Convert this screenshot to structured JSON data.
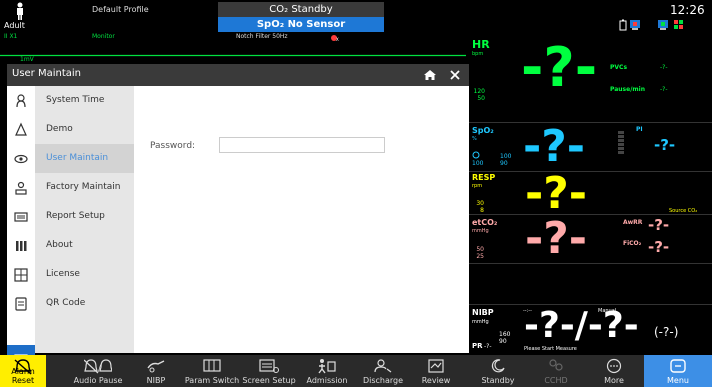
{
  "top": {
    "patient_type": "Adult",
    "profile": "Default Profile",
    "alarm_tech": "CO₂ Standby",
    "alarm_sensor": "SpO₂ No Sensor",
    "clock": "12:26"
  },
  "ecg": {
    "lead": "II  X1",
    "mode": "Monitor",
    "notch": "Notch Filter 50Hz",
    "scale": "1mV"
  },
  "dialog": {
    "title": "User Maintain",
    "password_label": "Password:",
    "password_value": "",
    "menu": [
      {
        "label": "System Time",
        "icon": "clock-icon"
      },
      {
        "label": "Demo",
        "icon": "bell-icon"
      },
      {
        "label": "User Maintain",
        "icon": "eye-icon"
      },
      {
        "label": "Factory Maintain",
        "icon": "factory-icon"
      },
      {
        "label": "Report Setup",
        "icon": "printer-icon"
      },
      {
        "label": "About",
        "icon": "bars-icon"
      },
      {
        "label": "License",
        "icon": "grid-icon"
      },
      {
        "label": "QR Code",
        "icon": "document-icon"
      }
    ],
    "active_item": "User Maintain"
  },
  "params": {
    "hr": {
      "label": "HR",
      "unit": "bpm",
      "hi": "120",
      "lo": "50",
      "value": "-?-",
      "pvcs_label": "PVCs",
      "pvcs_value": "-?-",
      "pause_label": "Pause/min",
      "pause_value": "-?-"
    },
    "spo2": {
      "label": "SpO₂",
      "unit": "%",
      "hi": "100",
      "lo": "90",
      "value": "-?-",
      "pi_label": "PI",
      "pi_value": "-?-",
      "extra_hi": "100"
    },
    "resp": {
      "label": "RESP",
      "unit": "rpm",
      "hi": "30",
      "lo": "8",
      "value": "-?-",
      "source": "Source CO₂"
    },
    "etco2": {
      "label": "etCO₂",
      "unit": "mmHg",
      "hi": "50",
      "lo": "25",
      "value": "-?-",
      "awrr_label": "AwRR",
      "awrr_value": "-?-",
      "fico2_label": "FiCO₂",
      "fico2_value": "-?-"
    },
    "nibp": {
      "label": "NIBP",
      "unit": "mmHg",
      "hi": "160",
      "lo": "90",
      "value": "-?-/-?-",
      "mean": "(-?-)",
      "mode": "Manual",
      "time": "--:--",
      "prompt": "Please Start Measure",
      "pr_label": "PR",
      "pr_value": "-?-"
    }
  },
  "bottom": [
    {
      "label": "Alarm Reset",
      "icon": "alarm-reset-icon"
    },
    {
      "label": "Audio Pause",
      "icon": "audio-pause-icon"
    },
    {
      "label": "NIBP",
      "icon": "nibp-icon"
    },
    {
      "label": "Param Switch",
      "icon": "param-switch-icon"
    },
    {
      "label": "Screen Setup",
      "icon": "screen-setup-icon"
    },
    {
      "label": "Admission",
      "icon": "admission-icon"
    },
    {
      "label": "Discharge",
      "icon": "discharge-icon"
    },
    {
      "label": "Review",
      "icon": "review-icon"
    },
    {
      "label": "Standby",
      "icon": "standby-icon"
    },
    {
      "label": "CCHD",
      "icon": "cchd-icon"
    },
    {
      "label": "More",
      "icon": "more-icon"
    },
    {
      "label": "Menu",
      "icon": "menu-icon"
    }
  ],
  "colors": {
    "hr": "#00ff40",
    "spo2": "#1ec8ff",
    "resp": "#ffff00",
    "etco2": "#ffaaaa",
    "nibp": "#ffffff",
    "alarm_blue": "#1e78d6",
    "alarm_reset_bg": "#ffee00",
    "menu_bg": "#3d8fe6"
  }
}
